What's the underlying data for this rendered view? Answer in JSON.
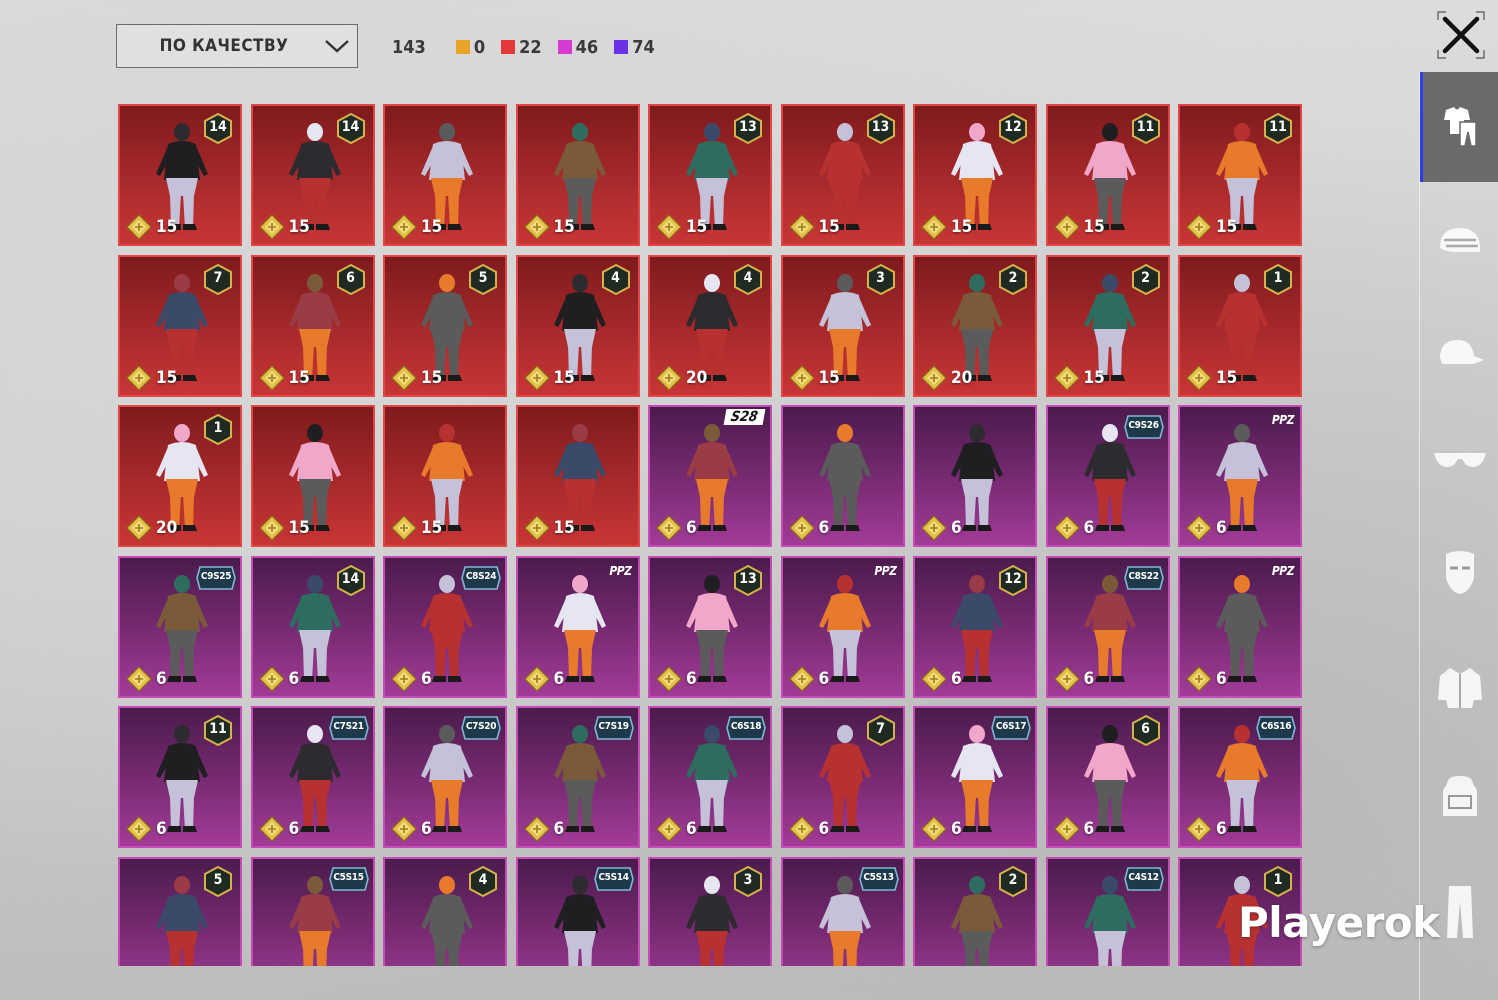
{
  "sort": {
    "label": "ПО КАЧЕСТВУ"
  },
  "counts": {
    "total": "143",
    "items": [
      {
        "name": "legendary",
        "color": "#e8a425",
        "value": "0"
      },
      {
        "name": "mythic",
        "color": "#e5383b",
        "value": "22"
      },
      {
        "name": "epic",
        "color": "#d63ad0",
        "value": "46"
      },
      {
        "name": "rare",
        "color": "#6a31e6",
        "value": "74"
      }
    ]
  },
  "sidebar": [
    "outfits-icon",
    "helmet-icon",
    "cap-icon",
    "glasses-icon",
    "mask-icon",
    "jacket-icon",
    "backpack-icon",
    "pants-icon"
  ],
  "cards": [
    {
      "rarity": "red",
      "badge": "14",
      "pts": "15"
    },
    {
      "rarity": "red",
      "badge": "14",
      "pts": "15"
    },
    {
      "rarity": "red",
      "badge": "",
      "pts": "15"
    },
    {
      "rarity": "red",
      "badge": "",
      "pts": "15"
    },
    {
      "rarity": "red",
      "badge": "13",
      "pts": "15"
    },
    {
      "rarity": "red",
      "badge": "13",
      "pts": "15"
    },
    {
      "rarity": "red",
      "badge": "12",
      "pts": "15"
    },
    {
      "rarity": "red",
      "badge": "11",
      "pts": "15"
    },
    {
      "rarity": "red",
      "badge": "11",
      "pts": "15"
    },
    {
      "rarity": "red",
      "badge": "7",
      "pts": "15"
    },
    {
      "rarity": "red",
      "badge": "6",
      "pts": "15"
    },
    {
      "rarity": "red",
      "badge": "5",
      "pts": "15"
    },
    {
      "rarity": "red",
      "badge": "4",
      "pts": "15"
    },
    {
      "rarity": "red",
      "badge": "4",
      "pts": "20"
    },
    {
      "rarity": "red",
      "badge": "3",
      "pts": "15"
    },
    {
      "rarity": "red",
      "badge": "2",
      "pts": "20"
    },
    {
      "rarity": "red",
      "badge": "2",
      "pts": "15"
    },
    {
      "rarity": "red",
      "badge": "1",
      "pts": "15"
    },
    {
      "rarity": "red",
      "badge": "1",
      "pts": "20"
    },
    {
      "rarity": "red",
      "badge": "",
      "pts": "15"
    },
    {
      "rarity": "red",
      "badge": "",
      "pts": "15"
    },
    {
      "rarity": "red",
      "badge": "",
      "pts": "15"
    },
    {
      "rarity": "purple",
      "banner": "S28",
      "pts": "6"
    },
    {
      "rarity": "purple",
      "badge": "",
      "pts": "6"
    },
    {
      "rarity": "purple",
      "badge": "",
      "pts": "6"
    },
    {
      "rarity": "purple",
      "season": "C9S26",
      "pts": "6"
    },
    {
      "rarity": "purple",
      "ppz": "PPZ",
      "pts": "6"
    },
    {
      "rarity": "purple",
      "season": "C9S25",
      "pts": "6"
    },
    {
      "rarity": "purple",
      "badge": "14",
      "pts": "6"
    },
    {
      "rarity": "purple",
      "season": "C8S24",
      "pts": "6"
    },
    {
      "rarity": "purple",
      "ppz": "PPZ",
      "pts": "6"
    },
    {
      "rarity": "purple",
      "badge": "13",
      "pts": "6"
    },
    {
      "rarity": "purple",
      "ppz": "PPZ",
      "pts": "6"
    },
    {
      "rarity": "purple",
      "badge": "12",
      "pts": "6"
    },
    {
      "rarity": "purple",
      "season": "C8S22",
      "pts": "6"
    },
    {
      "rarity": "purple",
      "ppz": "PPZ",
      "pts": "6"
    },
    {
      "rarity": "purple",
      "badge": "11",
      "pts": "6"
    },
    {
      "rarity": "purple",
      "season": "C7S21",
      "pts": "6"
    },
    {
      "rarity": "purple",
      "season": "C7S20",
      "pts": "6"
    },
    {
      "rarity": "purple",
      "season": "C7S19",
      "pts": "6"
    },
    {
      "rarity": "purple",
      "season": "C6S18",
      "pts": "6"
    },
    {
      "rarity": "purple",
      "badge": "7",
      "pts": "6"
    },
    {
      "rarity": "purple",
      "season": "C6S17",
      "pts": "6"
    },
    {
      "rarity": "purple",
      "badge": "6",
      "pts": "6"
    },
    {
      "rarity": "purple",
      "season": "C6S16",
      "pts": "6"
    },
    {
      "rarity": "purple",
      "badge": "5",
      "pts": ""
    },
    {
      "rarity": "purple",
      "season": "C5S15",
      "pts": ""
    },
    {
      "rarity": "purple",
      "badge": "4",
      "pts": ""
    },
    {
      "rarity": "purple",
      "season": "C5S14",
      "pts": ""
    },
    {
      "rarity": "purple",
      "badge": "3",
      "pts": ""
    },
    {
      "rarity": "purple",
      "season": "C5S13",
      "pts": ""
    },
    {
      "rarity": "purple",
      "badge": "2",
      "pts": ""
    },
    {
      "rarity": "purple",
      "season": "C4S12",
      "pts": ""
    },
    {
      "rarity": "purple",
      "badge": "1",
      "pts": ""
    }
  ],
  "palette": [
    "#1f1f22",
    "#2d2b30",
    "#c4c1d8",
    "#7b5a3a",
    "#2d6c5e",
    "#b83131",
    "#e6e6f2",
    "#f1a7c9",
    "#e87a2c",
    "#3c4a6a",
    "#9a3c45",
    "#5b5b5b"
  ],
  "watermark": "Playerok"
}
